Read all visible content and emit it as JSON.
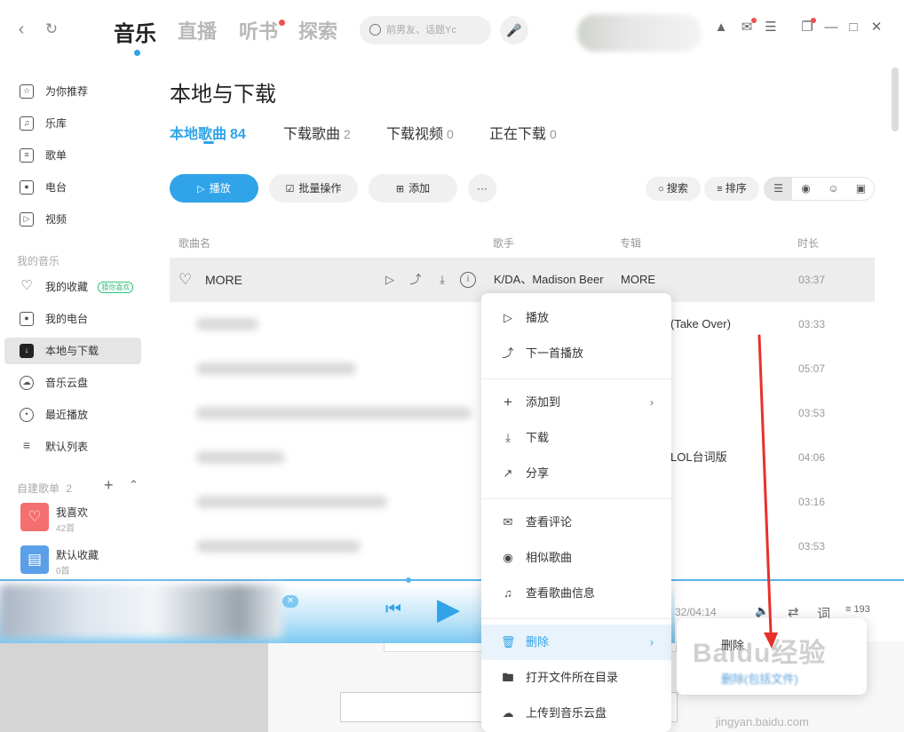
{
  "nav": {
    "tabs": [
      {
        "label": "音乐"
      },
      {
        "label": "直播"
      },
      {
        "label": "听书"
      },
      {
        "label": "探索"
      }
    ],
    "search_placeholder": "前男友、话题Yc"
  },
  "sidebar": {
    "items": [
      {
        "label": "为你推荐",
        "icon": "star-icon"
      },
      {
        "label": "乐库",
        "icon": "music-note-icon"
      },
      {
        "label": "歌单",
        "icon": "playlist-icon"
      },
      {
        "label": "电台",
        "icon": "radio-icon"
      },
      {
        "label": "视频",
        "icon": "video-icon"
      }
    ],
    "my_music_heading": "我的音乐",
    "my_items": [
      {
        "label": "我的收藏",
        "icon": "heart-icon"
      },
      {
        "label": "我的电台",
        "icon": "radio-icon"
      },
      {
        "label": "本地与下载",
        "icon": "download-icon"
      },
      {
        "label": "音乐云盘",
        "icon": "cloud-icon"
      },
      {
        "label": "最近播放",
        "icon": "clock-icon"
      },
      {
        "label": "默认列表",
        "icon": "list-icon"
      }
    ],
    "favorite_badge": "猜你喜欢",
    "custom_heading": "自建歌单",
    "custom_count": "2",
    "playlists": [
      {
        "name": "我喜欢",
        "count": "42首",
        "color": "#f46f6f"
      },
      {
        "name": "默认收藏",
        "count": "0首",
        "color": "#5a9fe8"
      }
    ]
  },
  "main": {
    "title": "本地与下载",
    "tabs": [
      {
        "label": "本地歌曲",
        "count": "84"
      },
      {
        "label": "下载歌曲",
        "count": "2"
      },
      {
        "label": "下载视频",
        "count": "0"
      },
      {
        "label": "正在下载",
        "count": "0"
      }
    ],
    "actions": {
      "play": "播放",
      "batch": "批量操作",
      "add": "添加",
      "more": "···",
      "search": "搜索",
      "sort": "排序"
    },
    "columns": {
      "title": "歌曲名",
      "artist": "歌手",
      "album": "专辑",
      "duration": "时长"
    },
    "rows": [
      {
        "title": "MORE",
        "artist": "K/DA、Madison Beer",
        "album": "MORE",
        "duration": "03:37"
      },
      {
        "title": "",
        "artist": "",
        "album": "(Take Over)",
        "duration": "03:33"
      },
      {
        "title": "",
        "artist": "",
        "album": "",
        "duration": "05:07"
      },
      {
        "title": "",
        "artist": "",
        "album": "",
        "duration": "03:53"
      },
      {
        "title": "",
        "artist": "",
        "album": "LOL台词版",
        "duration": "04:06"
      },
      {
        "title": "",
        "artist": "",
        "album": "",
        "duration": "03:16"
      },
      {
        "title": "",
        "artist": "",
        "album": "",
        "duration": "03:53"
      }
    ]
  },
  "player": {
    "time": "32/04:14",
    "lyrics_label": "词",
    "queue_count": "193"
  },
  "context_menu": {
    "items": [
      {
        "label": "播放",
        "icon": "play-icon"
      },
      {
        "label": "下一首播放",
        "icon": "play-next-icon"
      },
      {
        "label": "添加到",
        "icon": "plus-icon"
      },
      {
        "label": "下载",
        "icon": "download-icon"
      },
      {
        "label": "分享",
        "icon": "share-icon"
      },
      {
        "label": "查看评论",
        "icon": "comment-icon"
      },
      {
        "label": "相似歌曲",
        "icon": "signal-icon"
      },
      {
        "label": "查看歌曲信息",
        "icon": "music-info-icon"
      },
      {
        "label": "删除",
        "icon": "trash-icon"
      },
      {
        "label": "打开文件所在目录",
        "icon": "folder-icon"
      },
      {
        "label": "上传到音乐云盘",
        "icon": "cloud-upload-icon"
      }
    ]
  },
  "delete_submenu": {
    "item": "删除",
    "blurred_item": "删除(包括文件)"
  },
  "watermark": {
    "logo": "Baidu经验",
    "url": "jingyan.baidu.com"
  },
  "colors": {
    "accent": "#31a3e8",
    "red_dot": "#f24e4e",
    "highlight_row": "#ededed"
  }
}
